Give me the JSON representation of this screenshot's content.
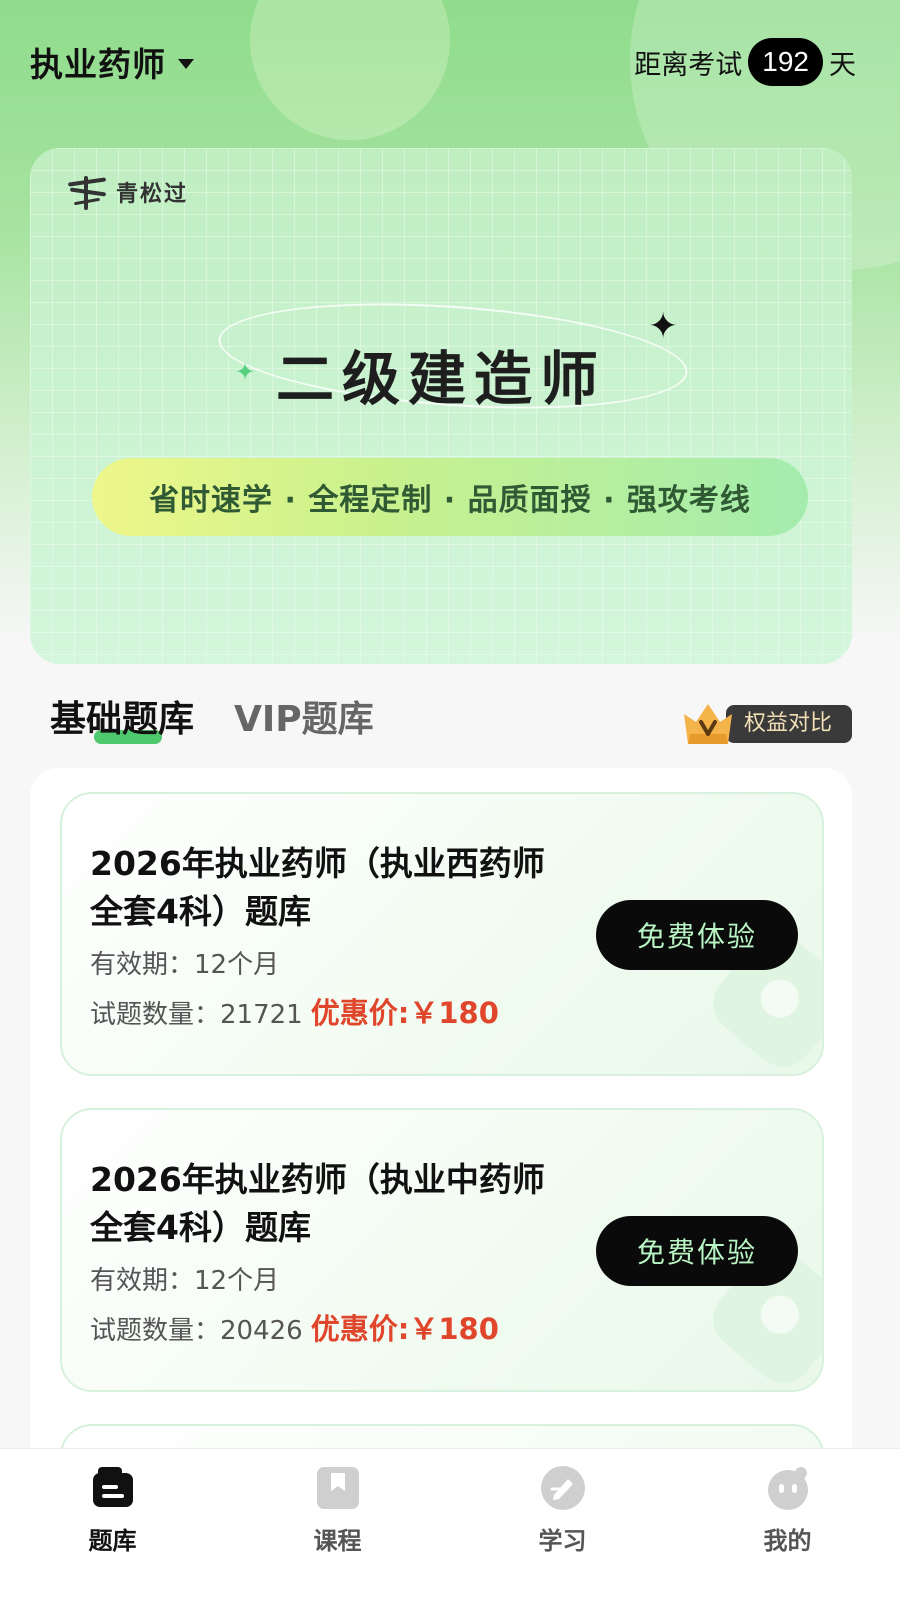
{
  "header": {
    "exam_title": "执业药师",
    "countdown_prefix": "距离考试",
    "countdown_days": "192",
    "countdown_suffix": "天"
  },
  "banner": {
    "brand_name": "青松过",
    "title": "二级建造师",
    "slogan": "省时速学 · 全程定制 · 品质面授 · 强攻考线"
  },
  "tabs": [
    {
      "label": "基础题库",
      "active": true
    },
    {
      "label": "VIP题库",
      "active": false
    }
  ],
  "benefit_label": "权益对比",
  "cards": [
    {
      "title": "2026年执业药师（执业西药师全套4科）题库",
      "validity": "有效期：12个月",
      "count_label": "试题数量：",
      "count": "21721",
      "price": "优惠价:￥180",
      "button": "免费体验"
    },
    {
      "title": "2026年执业药师（执业中药师全套4科）题库",
      "validity": "有效期：12个月",
      "count_label": "试题数量：",
      "count": "20426",
      "price": "优惠价:￥180",
      "button": "免费体验"
    }
  ],
  "nav": [
    {
      "label": "题库",
      "icon": "question-bank-icon",
      "active": true
    },
    {
      "label": "课程",
      "icon": "bookmark-book-icon",
      "active": false
    },
    {
      "label": "学习",
      "icon": "pen-icon",
      "active": false
    },
    {
      "label": "我的",
      "icon": "face-icon",
      "active": false
    }
  ],
  "colors": {
    "accent_green": "#4fc96e",
    "price_red": "#e0462b",
    "button_black": "#0a0a0a"
  }
}
